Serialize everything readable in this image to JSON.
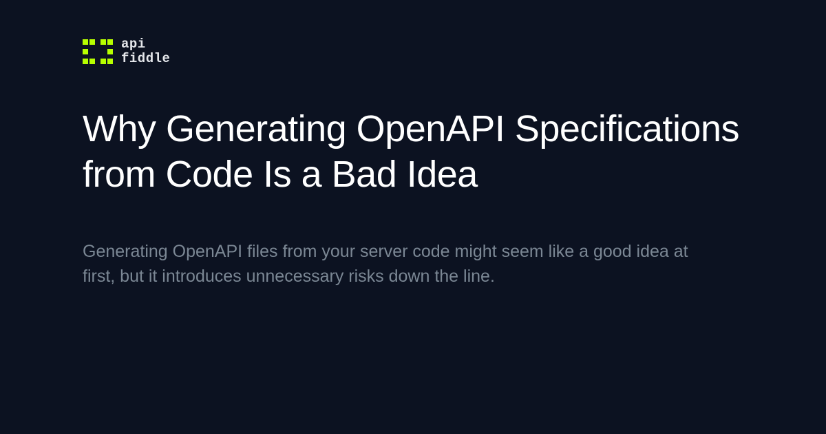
{
  "logo": {
    "line1": "api",
    "line2": "fiddle",
    "accent_color": "#b8ff00"
  },
  "article": {
    "title": "Why Generating OpenAPI Specifications from Code Is a Bad Idea",
    "description": "Generating OpenAPI files from your server code might seem like a good idea at first, but it introduces unnecessary risks down the line."
  }
}
